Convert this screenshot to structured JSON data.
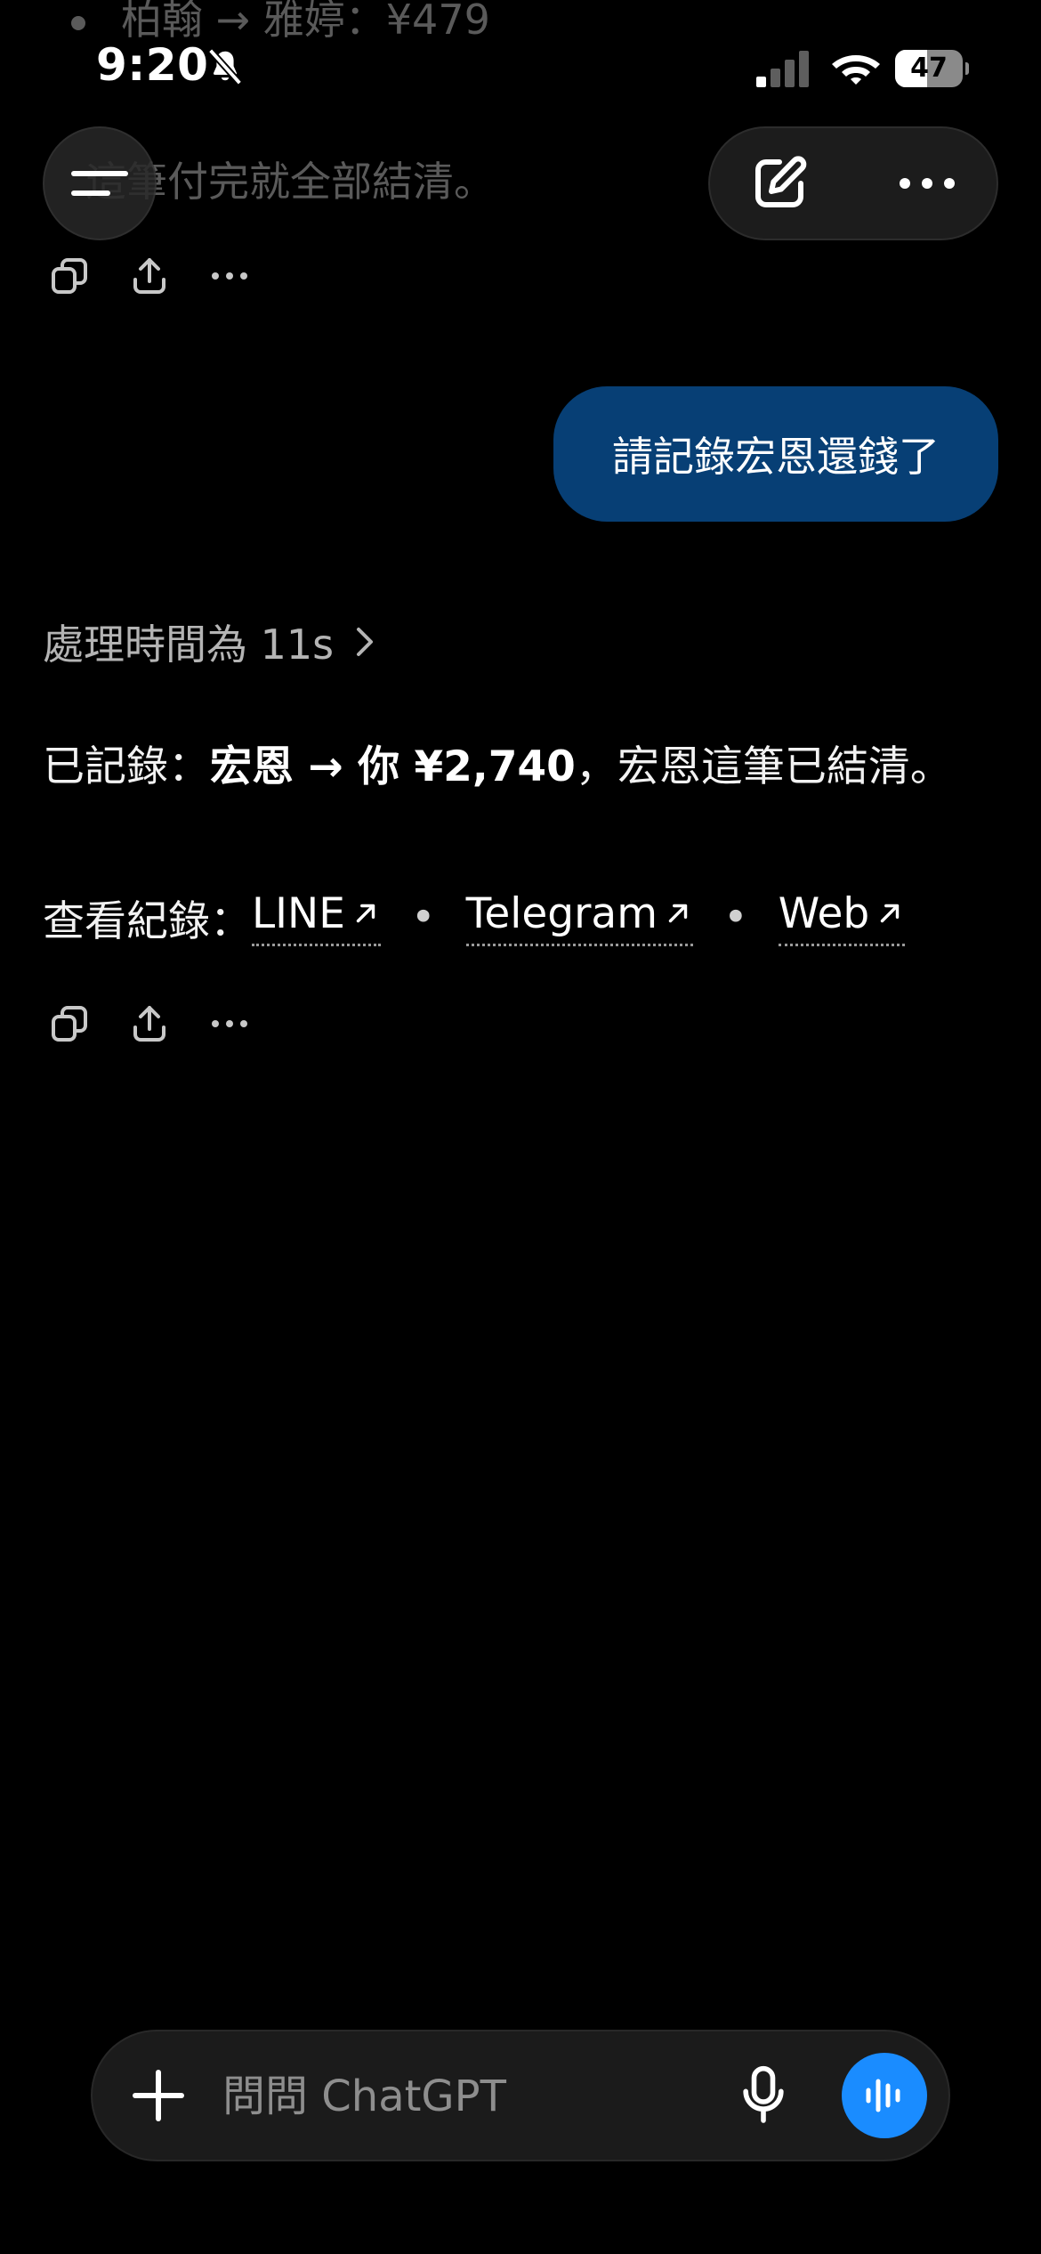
{
  "status_bar": {
    "time": "9:20",
    "battery_text": "47",
    "battery_level": 0.47
  },
  "previous_message": {
    "bullet_line": "柏翰 → 雅婷：¥479",
    "summary_line": "這筆付完就全部結清。"
  },
  "conversation": {
    "user_message": "請記錄宏恩還錢了",
    "thinking_label": "處理時間為 11s",
    "answer": {
      "prefix": "已記錄：",
      "bold": "宏恩 → 你 ¥2,740",
      "suffix": "，宏恩這筆已結清。"
    },
    "links": {
      "prefix": "查看紀錄：",
      "items": [
        "LINE",
        "Telegram",
        "Web"
      ],
      "separator": "•"
    }
  },
  "composer": {
    "placeholder": "問問 ChatGPT"
  },
  "icons": {
    "menu": "menu-icon",
    "compose": "compose-icon",
    "more": "more-icon",
    "copy": "copy-icon",
    "share": "share-icon",
    "plus": "plus-icon",
    "mic": "microphone-icon",
    "voice": "voice-waveform-icon"
  },
  "colors": {
    "background": "#000000",
    "user_bubble": "#073f75",
    "voice_button": "#1a8cff"
  }
}
